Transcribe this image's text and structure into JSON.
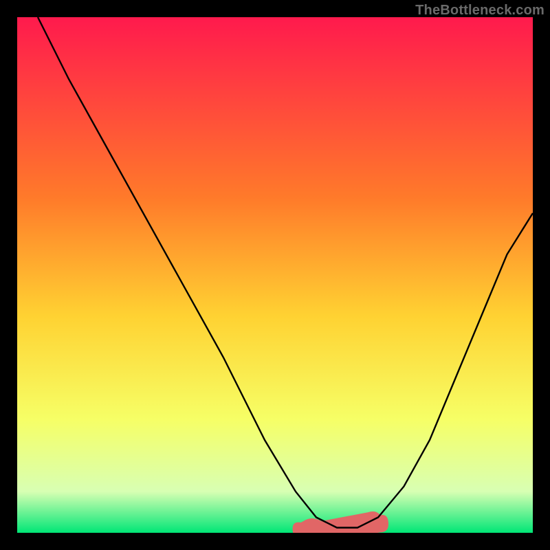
{
  "attribution": "TheBottleneck.com",
  "colors": {
    "bg": "#000000",
    "grad_top": "#ff1a4d",
    "grad_upper_mid": "#ff7a2a",
    "grad_mid": "#ffd232",
    "grad_lower_mid": "#f6ff66",
    "grad_low": "#d8ffb3",
    "grad_bottom": "#00e676",
    "curve": "#000000",
    "blob": "#e16666"
  },
  "chart_data": {
    "type": "line",
    "title": "",
    "xlabel": "",
    "ylabel": "",
    "xlim": [
      0,
      100
    ],
    "ylim": [
      0,
      100
    ],
    "series": [
      {
        "name": "bottleneck-curve",
        "x": [
          4,
          10,
          20,
          30,
          40,
          48,
          54,
          58,
          62,
          66,
          70,
          75,
          80,
          85,
          90,
          95,
          100
        ],
        "y": [
          100,
          88,
          70,
          52,
          34,
          18,
          8,
          3,
          1,
          1,
          3,
          9,
          18,
          30,
          42,
          54,
          62
        ]
      }
    ],
    "annotations": [
      {
        "name": "valley-blob",
        "x_range": [
          55,
          72
        ],
        "y": 2
      }
    ]
  }
}
